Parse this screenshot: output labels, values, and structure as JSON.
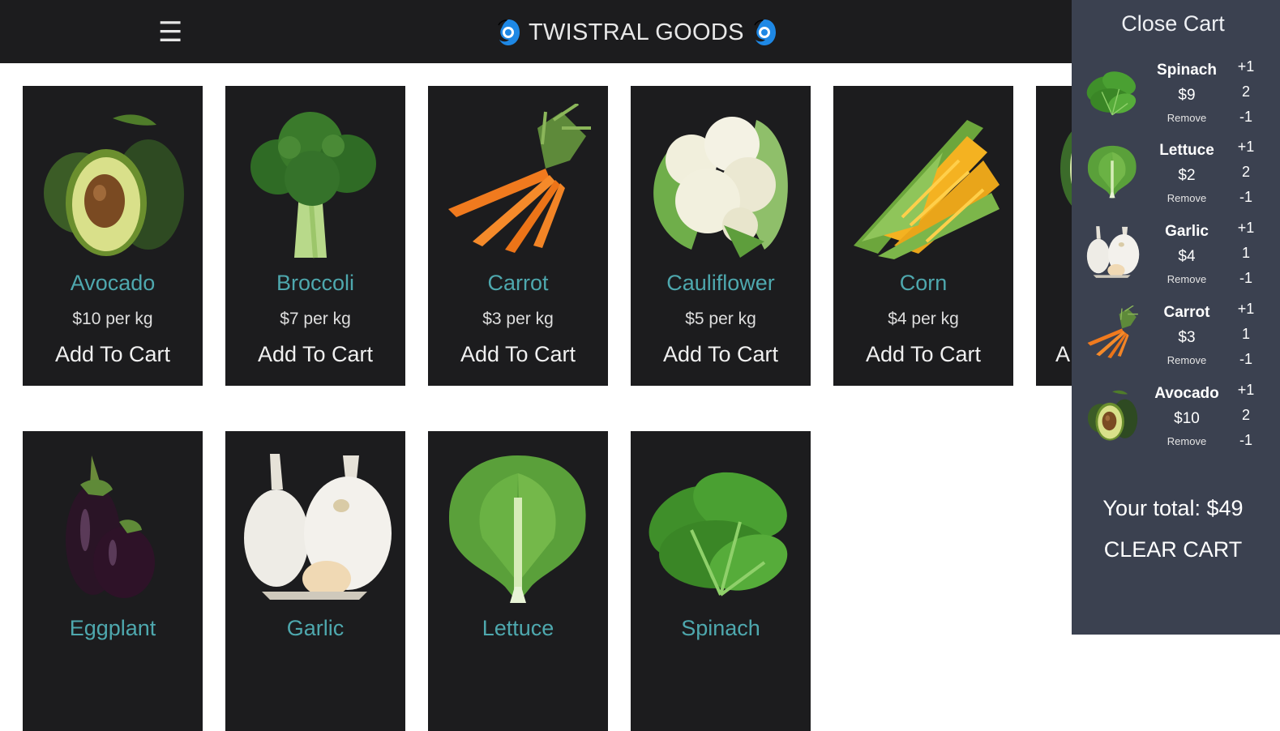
{
  "header": {
    "menu_icon": "hamburger-icon",
    "title": "TWISTRAL GOODS",
    "logo_icon": "swirl-icon",
    "logo_color": "#1e88e5"
  },
  "colors": {
    "card_bg": "#1c1c1e",
    "name": "#4ea8ae",
    "cart_bg": "#3b4150"
  },
  "products": [
    {
      "name": "Avocado",
      "price": "$10 per kg",
      "add": "Add To Cart",
      "icon": "avocado-icon"
    },
    {
      "name": "Broccoli",
      "price": "$7 per kg",
      "add": "Add To Cart",
      "icon": "broccoli-icon"
    },
    {
      "name": "Carrot",
      "price": "$3 per kg",
      "add": "Add To Cart",
      "icon": "carrot-icon"
    },
    {
      "name": "Cauliflower",
      "price": "$5 per kg",
      "add": "Add To Cart",
      "icon": "cauliflower-icon"
    },
    {
      "name": "Corn",
      "price": "$4 per kg",
      "add": "Add To Cart",
      "icon": "corn-icon"
    },
    {
      "name": "",
      "price": "",
      "add": "A",
      "icon": "cucumber-icon"
    },
    {
      "name": "Eggplant",
      "price": "",
      "add": "",
      "icon": "eggplant-icon"
    },
    {
      "name": "Garlic",
      "price": "",
      "add": "",
      "icon": "garlic-icon"
    },
    {
      "name": "Lettuce",
      "price": "",
      "add": "",
      "icon": "lettuce-icon"
    },
    {
      "name": "Spinach",
      "price": "",
      "add": "",
      "icon": "spinach-icon"
    }
  ],
  "cart": {
    "close_label": "Close Cart",
    "items": [
      {
        "name": "Spinach",
        "price": "$9",
        "remove": "Remove",
        "plus": "+1",
        "qty": "2",
        "minus": "-1",
        "icon": "spinach-icon"
      },
      {
        "name": "Lettuce",
        "price": "$2",
        "remove": "Remove",
        "plus": "+1",
        "qty": "2",
        "minus": "-1",
        "icon": "lettuce-icon"
      },
      {
        "name": "Garlic",
        "price": "$4",
        "remove": "Remove",
        "plus": "+1",
        "qty": "1",
        "minus": "-1",
        "icon": "garlic-icon"
      },
      {
        "name": "Carrot",
        "price": "$3",
        "remove": "Remove",
        "plus": "+1",
        "qty": "1",
        "minus": "-1",
        "icon": "carrot-icon"
      },
      {
        "name": "Avocado",
        "price": "$10",
        "remove": "Remove",
        "plus": "+1",
        "qty": "2",
        "minus": "-1",
        "icon": "avocado-icon"
      }
    ],
    "total": "Your total: $49",
    "clear_label": "CLEAR CART"
  }
}
